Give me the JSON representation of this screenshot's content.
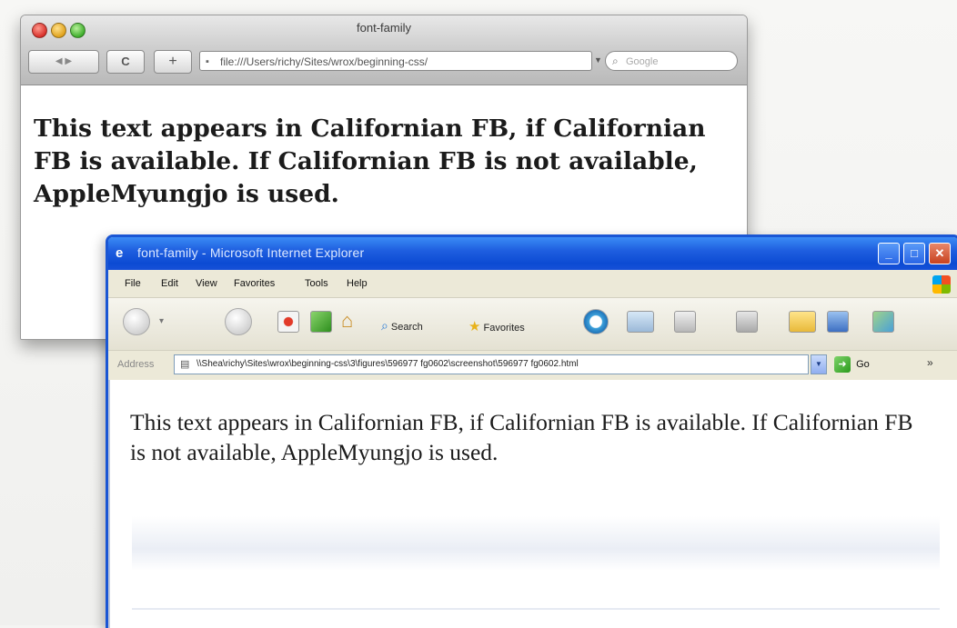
{
  "mac_window": {
    "title": "font-family",
    "address": "file:///Users/richy/Sites/wrox/beginning-css/",
    "search_placeholder": "Google",
    "reload_label": "C",
    "add_label": "+",
    "content_text": "This text appears in Californian FB, if Californian FB is available. If Californian FB is not available, AppleMyungjo is used."
  },
  "ie_window": {
    "title": "font-family - Microsoft Internet Explorer",
    "menu": {
      "file": "File",
      "edit": "Edit",
      "view": "View",
      "favorites": "Favorites",
      "tools": "Tools",
      "help": "Help"
    },
    "toolbar": {
      "search_label": "Search",
      "favorites_label": "Favorites"
    },
    "address_label": "Address",
    "address": "\\\\Shea\\richy\\Sites\\wrox\\beginning-css\\3\\figures\\596977 fg0602\\screenshot\\596977 fg0602.html",
    "go_label": "Go",
    "links_label": "»",
    "content_text": "This text appears in Californian FB, if Californian FB is available. If Californian FB is not available, AppleMyungjo is used."
  }
}
